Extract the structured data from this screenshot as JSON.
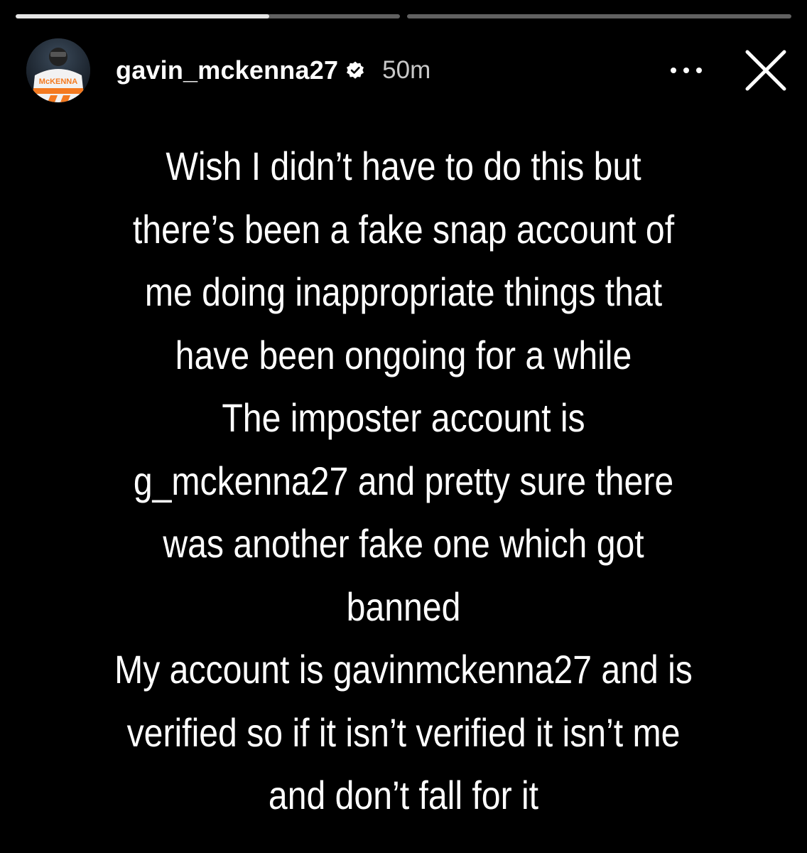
{
  "progress": {
    "segments": [
      {
        "fill_fraction": 0.66
      },
      {
        "fill_fraction": 0.0
      }
    ]
  },
  "header": {
    "avatar": {
      "jersey_text": "McKENNA"
    },
    "username": "gavin_mckenna27",
    "verified_icon": "verified-badge-icon",
    "timestamp": "50m",
    "more_icon": "more-dots-icon",
    "close_icon": "close-icon"
  },
  "story": {
    "lines": [
      "Wish I didn’t have to do this but",
      "there’s been a fake snap account of",
      "me doing inappropriate things that",
      "have been ongoing for a while",
      "The imposter account is",
      "g_mckenna27 and pretty sure there",
      "was another fake one which got",
      "banned",
      "My account is gavinmckenna27 and is",
      "verified so if it isn’t verified it isn’t me",
      "and don’t fall for it"
    ]
  },
  "colors": {
    "background": "#000000",
    "text": "#ffffff",
    "timestamp": "#c9c9c9",
    "jersey_orange": "#f47a20"
  }
}
